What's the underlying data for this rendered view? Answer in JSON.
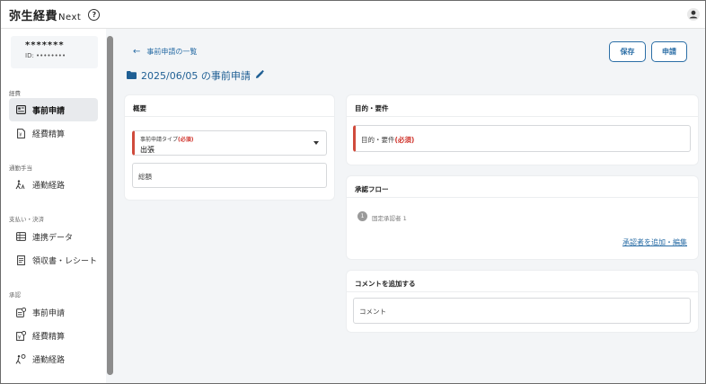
{
  "header": {
    "app_name": "弥生経費",
    "app_suffix": "Next"
  },
  "sidebar": {
    "user": {
      "name_masked": "*******",
      "id_masked": "ID: ••••••••"
    },
    "sections": [
      {
        "label": "経費",
        "items": [
          {
            "label": "事前申請",
            "icon": "application-icon",
            "active": true
          },
          {
            "label": "経費精算",
            "icon": "receipt-doc-icon",
            "active": false
          }
        ]
      },
      {
        "label": "通勤手当",
        "items": [
          {
            "label": "通勤経路",
            "icon": "commute-icon",
            "active": false
          }
        ]
      },
      {
        "label": "支払い・決済",
        "items": [
          {
            "label": "連携データ",
            "icon": "data-grid-icon",
            "active": false
          },
          {
            "label": "領収書・レシート",
            "icon": "receipt-icon",
            "active": false
          }
        ]
      },
      {
        "label": "承認",
        "items": [
          {
            "label": "事前申請",
            "icon": "approve-application-icon",
            "active": false
          },
          {
            "label": "経費精算",
            "icon": "approve-expense-icon",
            "active": false
          },
          {
            "label": "通勤経路",
            "icon": "approve-commute-icon",
            "active": false
          }
        ]
      }
    ]
  },
  "main": {
    "back_label": "事前申請の一覧",
    "title": "2025/06/05 の事前申請",
    "save_label": "保存",
    "apply_label": "申請",
    "overview": {
      "title": "概要",
      "type_label": "事前申請タイプ",
      "required_mark": "(必須)",
      "type_value": "出張",
      "amount_placeholder": "総額"
    },
    "purpose": {
      "title": "目的・要件",
      "field_label": "目的・要件",
      "required_mark": "(必須)"
    },
    "approval": {
      "title": "承認フロー",
      "step_number": "1",
      "step_label": "固定承認者 1",
      "add_edit_label": "承認者を追加・編集"
    },
    "comment": {
      "title": "コメントを追加する",
      "placeholder": "コメント"
    }
  },
  "colors": {
    "accent": "#2b6ea6",
    "required": "#d04b3c",
    "active_nav_bg": "#e8eaed"
  }
}
